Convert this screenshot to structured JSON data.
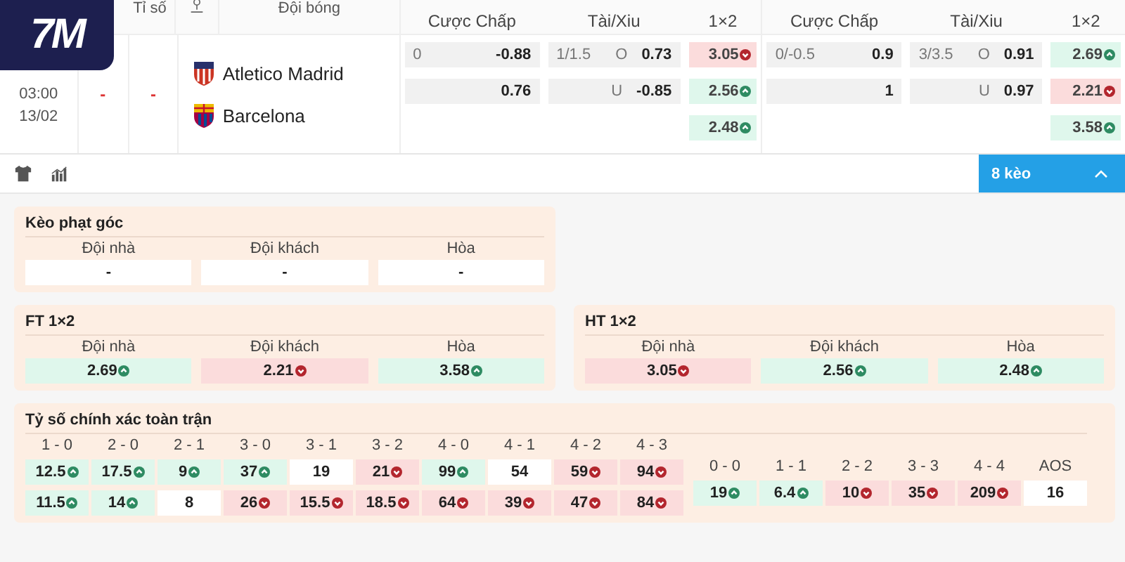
{
  "logo": {
    "text": "7M"
  },
  "header": {
    "columns": [
      "Tỉ số",
      "Đội bóng"
    ],
    "groups": [
      {
        "columns": [
          "Cược Chấp",
          "Tài/Xiu",
          "1×2"
        ]
      },
      {
        "columns": [
          "Cược Chấp",
          "Tài/Xiu",
          "1×2"
        ]
      }
    ]
  },
  "match": {
    "time": "03:00",
    "date": "13/02",
    "score_1": "-",
    "score_2": "-",
    "teams": [
      {
        "name": "Atletico Madrid"
      },
      {
        "name": "Barcelona"
      }
    ],
    "markets": [
      {
        "handicap": [
          {
            "line": "0",
            "odds": "-0.88"
          },
          {
            "odds": "0.76"
          }
        ],
        "over_under": [
          {
            "line": "1/1.5",
            "side": "O",
            "odds": "0.73"
          },
          {
            "side": "U",
            "odds": "-0.85"
          }
        ],
        "result": [
          {
            "odds": "3.05",
            "kind": "down"
          },
          {
            "odds": "2.56",
            "kind": "up"
          },
          {
            "odds": "2.48",
            "kind": "up"
          }
        ]
      },
      {
        "handicap": [
          {
            "line": "0/-0.5",
            "odds": "0.9"
          },
          {
            "odds": "1"
          }
        ],
        "over_under": [
          {
            "line": "3/3.5",
            "side": "O",
            "odds": "0.91"
          },
          {
            "side": "U",
            "odds": "0.97"
          }
        ],
        "result": [
          {
            "odds": "2.69",
            "kind": "up"
          },
          {
            "odds": "2.21",
            "kind": "down"
          },
          {
            "odds": "3.58",
            "kind": "up"
          }
        ]
      }
    ]
  },
  "toolbar": {
    "button": {
      "label": "8 kèo",
      "expanded": true
    }
  },
  "sections": [
    {
      "panels": [
        {
          "title": "Kèo phạt góc",
          "options": [
            {
              "label": "Đội nhà",
              "odds": "-",
              "kind": "plain"
            },
            {
              "label": "Đội khách",
              "odds": "-",
              "kind": "plain"
            },
            {
              "label": "Hòa",
              "odds": "-",
              "kind": "plain"
            }
          ]
        }
      ]
    },
    {
      "panels": [
        {
          "title": "FT 1×2",
          "options": [
            {
              "label": "Đội nhà",
              "odds": "2.69",
              "kind": "up"
            },
            {
              "label": "Đội khách",
              "odds": "2.21",
              "kind": "down"
            },
            {
              "label": "Hòa",
              "odds": "3.58",
              "kind": "up"
            }
          ]
        },
        {
          "title": "HT 1×2",
          "options": [
            {
              "label": "Đội nhà",
              "odds": "3.05",
              "kind": "down"
            },
            {
              "label": "Đội khách",
              "odds": "2.56",
              "kind": "up"
            },
            {
              "label": "Hòa",
              "odds": "2.48",
              "kind": "up"
            }
          ]
        }
      ]
    }
  ],
  "correct_score": {
    "title": "Tỷ số chính xác toàn trận",
    "columns": [
      {
        "label": "1 - 0",
        "odds": [
          {
            "value": "12.5",
            "kind": "up"
          },
          {
            "value": "11.5",
            "kind": "up"
          }
        ]
      },
      {
        "label": "2 - 0",
        "odds": [
          {
            "value": "17.5",
            "kind": "up"
          },
          {
            "value": "14",
            "kind": "up"
          }
        ]
      },
      {
        "label": "2 - 1",
        "odds": [
          {
            "value": "9",
            "kind": "up"
          },
          {
            "value": "8",
            "kind": "plain"
          }
        ]
      },
      {
        "label": "3 - 0",
        "odds": [
          {
            "value": "37",
            "kind": "up"
          },
          {
            "value": "26",
            "kind": "down"
          }
        ]
      },
      {
        "label": "3 - 1",
        "odds": [
          {
            "value": "19",
            "kind": "plain"
          },
          {
            "value": "15.5",
            "kind": "down"
          }
        ]
      },
      {
        "label": "3 - 2",
        "odds": [
          {
            "value": "21",
            "kind": "down"
          },
          {
            "value": "18.5",
            "kind": "down"
          }
        ]
      },
      {
        "label": "4 - 0",
        "odds": [
          {
            "value": "99",
            "kind": "up"
          },
          {
            "value": "64",
            "kind": "down"
          }
        ]
      },
      {
        "label": "4 - 1",
        "odds": [
          {
            "value": "54",
            "kind": "plain"
          },
          {
            "value": "39",
            "kind": "down"
          }
        ]
      },
      {
        "label": "4 - 2",
        "odds": [
          {
            "value": "59",
            "kind": "down"
          },
          {
            "value": "47",
            "kind": "down"
          }
        ]
      },
      {
        "label": "4 - 3",
        "odds": [
          {
            "value": "94",
            "kind": "down"
          },
          {
            "value": "84",
            "kind": "down"
          }
        ]
      }
    ],
    "draws": [
      {
        "label": "0 - 0",
        "odds": {
          "value": "19",
          "kind": "up"
        }
      },
      {
        "label": "1 - 1",
        "odds": {
          "value": "6.4",
          "kind": "up"
        }
      },
      {
        "label": "2 - 2",
        "odds": {
          "value": "10",
          "kind": "down"
        }
      },
      {
        "label": "3 - 3",
        "odds": {
          "value": "35",
          "kind": "down"
        }
      },
      {
        "label": "4 - 4",
        "odds": {
          "value": "209",
          "kind": "down"
        }
      },
      {
        "label": "AOS",
        "odds": {
          "value": "16",
          "kind": "plain"
        }
      }
    ]
  }
}
